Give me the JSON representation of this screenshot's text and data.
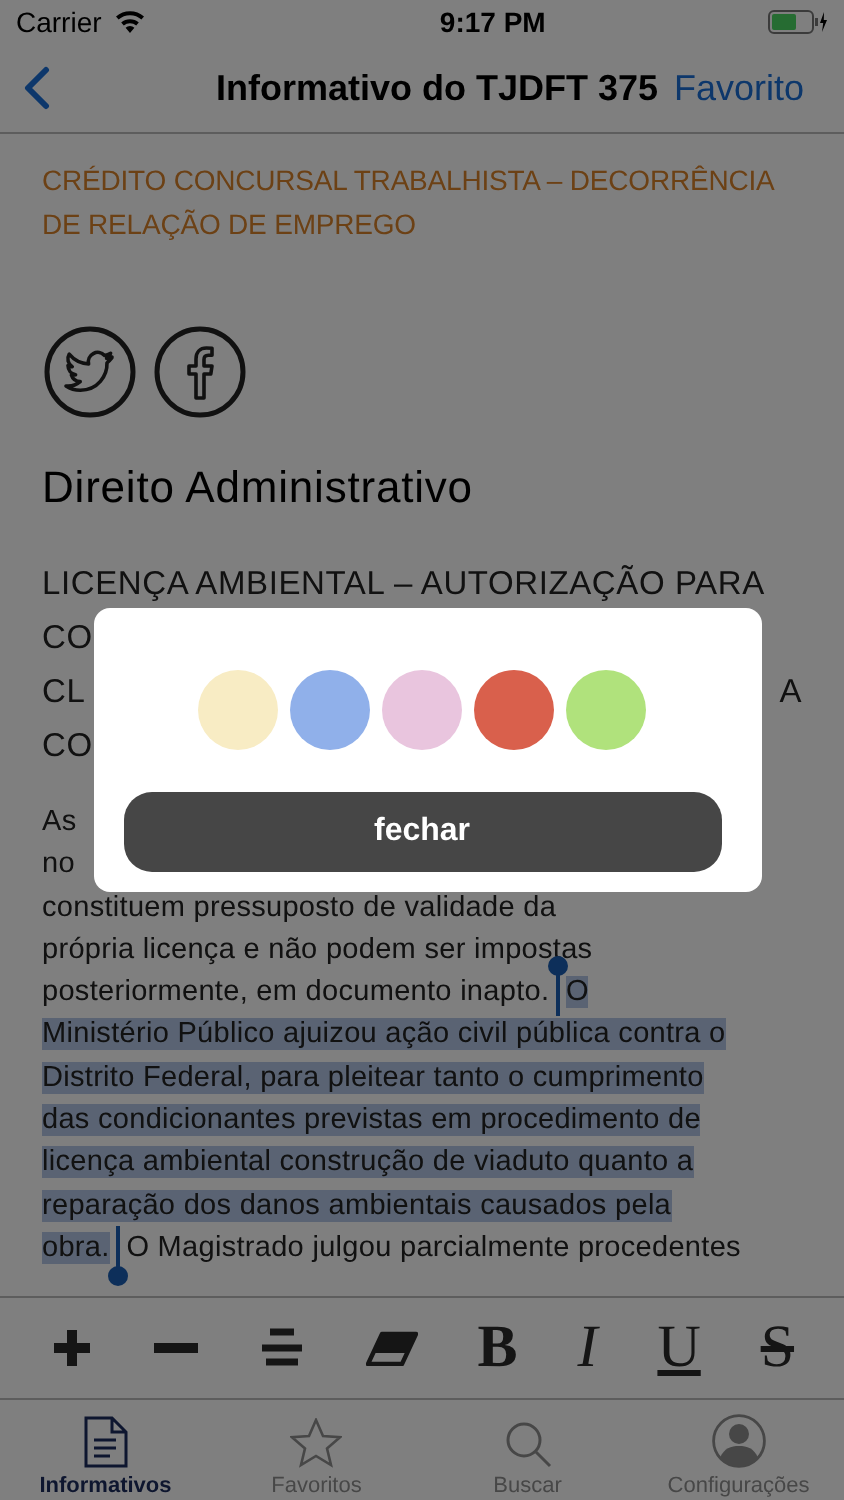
{
  "status_bar": {
    "carrier": "Carrier",
    "time": "9:17 PM"
  },
  "nav": {
    "title": "Informativo do TJDFT 375",
    "action": "Favorito"
  },
  "article": {
    "topic": "CRÉDITO CONCURSAL TRABALHISTA – DECORRÊNCIA DE RELAÇÃO DE EMPREGO",
    "section": "Direito Administrativo",
    "heading_lines": [
      {
        "text": "LICENÇA AMBIENTAL – AUTORIZAÇÃO PARA"
      },
      {
        "text": "CO"
      },
      {
        "text": "CL",
        "right": "A"
      },
      {
        "text": "CO"
      }
    ],
    "paragraph_lines": [
      {
        "parts": [
          {
            "text": "As",
            "selected": false
          }
        ]
      },
      {
        "parts": [
          {
            "text": "no",
            "selected": false
          }
        ]
      },
      {
        "parts": [
          {
            "text": "constituem pressuposto de validade da",
            "selected": false
          }
        ]
      },
      {
        "parts": [
          {
            "text": "própria licença e não podem ser impostas",
            "selected": false
          }
        ]
      },
      {
        "parts": [
          {
            "text": "posteriormente, em documento inapto. ",
            "selected": false
          },
          {
            "text": "O",
            "selected": true
          }
        ]
      },
      {
        "parts": [
          {
            "text": "Ministério Público ajuizou ação civil pública contra o",
            "selected": true
          }
        ]
      },
      {
        "parts": [
          {
            "text": "Distrito Federal, para pleitear tanto o cumprimento",
            "selected": true
          }
        ]
      },
      {
        "parts": [
          {
            "text": "das condicionantes previstas em procedimento de",
            "selected": true
          }
        ]
      },
      {
        "parts": [
          {
            "text": "licença ambiental construção de viaduto quanto a",
            "selected": true
          }
        ]
      },
      {
        "parts": [
          {
            "text": "reparação dos danos ambientais causados pela",
            "selected": true
          }
        ]
      },
      {
        "parts": [
          {
            "text": "obra.",
            "selected": true
          },
          {
            "text": " O Magistrado julgou parcialmente procedentes",
            "selected": false
          }
        ]
      }
    ]
  },
  "toolbar": [
    {
      "kind": "plus"
    },
    {
      "kind": "minus"
    },
    {
      "kind": "align"
    },
    {
      "kind": "eraser"
    },
    {
      "kind": "bold",
      "label": "B"
    },
    {
      "kind": "italic",
      "label": "I"
    },
    {
      "kind": "underline",
      "label": "U"
    },
    {
      "kind": "strike",
      "label": "S"
    }
  ],
  "tabs": [
    {
      "label": "Informativos",
      "selected": true
    },
    {
      "label": "Favoritos",
      "selected": false
    },
    {
      "label": "Buscar",
      "selected": false
    },
    {
      "label": "Configurações",
      "selected": false
    }
  ],
  "color_dialog": {
    "colors": [
      {
        "color": "#f8ecc4"
      },
      {
        "color": "#90b0ea"
      },
      {
        "color": "#e9c5de"
      },
      {
        "color": "#d9604c"
      },
      {
        "color": "#b0e27c"
      }
    ],
    "button": "fechar"
  }
}
